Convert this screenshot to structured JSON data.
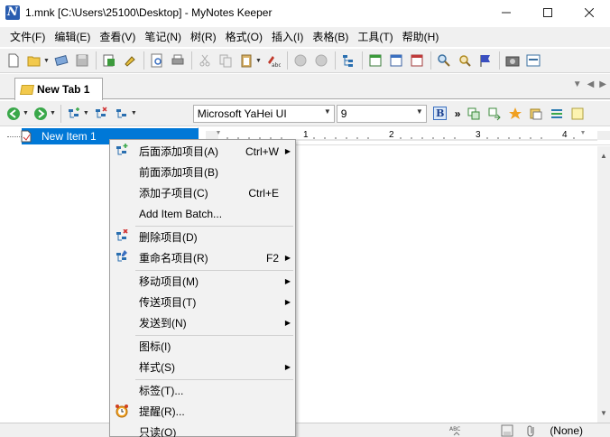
{
  "window": {
    "title": "1.mnk [C:\\Users\\25100\\Desktop] - MyNotes Keeper",
    "app_icon_letter": "N"
  },
  "menubar": {
    "items": [
      "文件(F)",
      "编辑(E)",
      "查看(V)",
      "笔记(N)",
      "树(R)",
      "格式(O)",
      "插入(I)",
      "表格(B)",
      "工具(T)",
      "帮助(H)"
    ]
  },
  "tabs": [
    {
      "label": "New Tab 1"
    }
  ],
  "format_bar": {
    "font_name": "Microsoft YaHei UI",
    "font_size": "9",
    "bold_label": "B",
    "more_label": "»"
  },
  "tree": {
    "items": [
      {
        "label": "New Item 1",
        "selected": true
      }
    ]
  },
  "ruler": {
    "numbers": [
      "1",
      "2",
      "3",
      "4"
    ]
  },
  "context_menu": {
    "items": [
      {
        "label": "后面添加项目(A)",
        "shortcut": "Ctrl+W",
        "submenu": true,
        "icon": "add-item-after-icon"
      },
      {
        "label": "前面添加项目(B)",
        "shortcut": "",
        "submenu": false,
        "icon": ""
      },
      {
        "label": "添加子项目(C)",
        "shortcut": "Ctrl+E",
        "submenu": false,
        "icon": ""
      },
      {
        "label": "Add Item Batch...",
        "shortcut": "",
        "submenu": false,
        "icon": ""
      },
      {
        "label": "删除项目(D)",
        "shortcut": "",
        "submenu": false,
        "icon": "delete-item-icon"
      },
      {
        "label": "重命名项目(R)",
        "shortcut": "F2",
        "submenu": true,
        "icon": "rename-item-icon"
      },
      {
        "label": "移动项目(M)",
        "shortcut": "",
        "submenu": true,
        "icon": ""
      },
      {
        "label": "传送项目(T)",
        "shortcut": "",
        "submenu": true,
        "icon": ""
      },
      {
        "label": "发送到(N)",
        "shortcut": "",
        "submenu": true,
        "icon": ""
      },
      {
        "label": "图标(I)",
        "shortcut": "",
        "submenu": false,
        "icon": ""
      },
      {
        "label": "样式(S)",
        "shortcut": "",
        "submenu": true,
        "icon": ""
      },
      {
        "label": "标签(T)...",
        "shortcut": "",
        "submenu": false,
        "icon": ""
      },
      {
        "label": "提醒(R)...",
        "shortcut": "",
        "submenu": false,
        "icon": "alarm-clock-icon"
      },
      {
        "label": "只读(O)",
        "shortcut": "",
        "submenu": false,
        "icon": ""
      }
    ]
  },
  "statusbar": {
    "tag_text": "(None)"
  },
  "colors": {
    "selection": "#0078d7",
    "menu_bg": "#f2f2f2",
    "chrome_bg": "#f0f0f0"
  }
}
